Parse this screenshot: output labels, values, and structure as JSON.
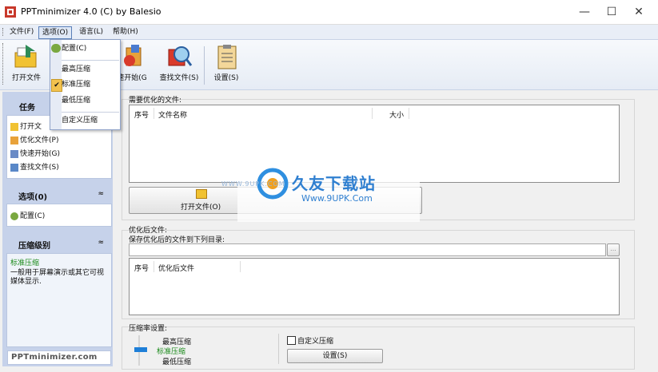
{
  "window": {
    "title": "PPTminimizer 4.0 (C) by Balesio"
  },
  "menu": {
    "items": [
      "文件(F)",
      "选项(O)",
      "语言(L)",
      "帮助(H)"
    ],
    "active_index": 1
  },
  "dropdown": {
    "items": [
      "配置(C)",
      "最高压缩",
      "标准压缩",
      "最低压缩",
      "自定义压缩"
    ],
    "checked": "标准压缩"
  },
  "toolbar": {
    "open_label": "打开文件",
    "quickstart_label": "速开始(G",
    "find_label": "查找文件(S)",
    "settings_label": "设置(S)"
  },
  "left_panel": {
    "tasks_title": "任务",
    "task_items": [
      "打开文",
      "优化文件(P)",
      "快速开始(G)",
      "查找文件(S)"
    ],
    "options_title": "选项(0)",
    "options_items": [
      "配置(C)"
    ],
    "compression_title": "压缩级别",
    "compression_level": "标准压缩",
    "compression_desc": "一般用于屏幕演示或其它可视媒体显示.",
    "logo_text": "PPTminimizer.com"
  },
  "files_section": {
    "title": "需要优化的文件:",
    "col_index": "序号",
    "col_name": "文件名称",
    "col_size": "大小",
    "open_button": "打开文件(O)"
  },
  "output_section": {
    "title": "优化后文件:",
    "subtitle": "保存优化后的文件到下列目录:",
    "path_value": "",
    "browse_button": "...",
    "col_index": "序号",
    "col_name": "优化后文件"
  },
  "compression_settings": {
    "title": "压缩率设置:",
    "levels": [
      "最高压缩",
      "标准压缩",
      "最低压缩"
    ],
    "selected": "标准压缩",
    "custom_checkbox": "自定义压缩",
    "custom_checked": false,
    "settings_button": "设置(S)"
  },
  "watermark": {
    "brand": "久友下载站",
    "url": "Www.9UPK.Com",
    "url_small": "WWW.9UPK.COM"
  },
  "colors": {
    "accent": "#5a7fb8",
    "panel": "#c6d2ea",
    "selected_green": "#1a8a1a"
  }
}
